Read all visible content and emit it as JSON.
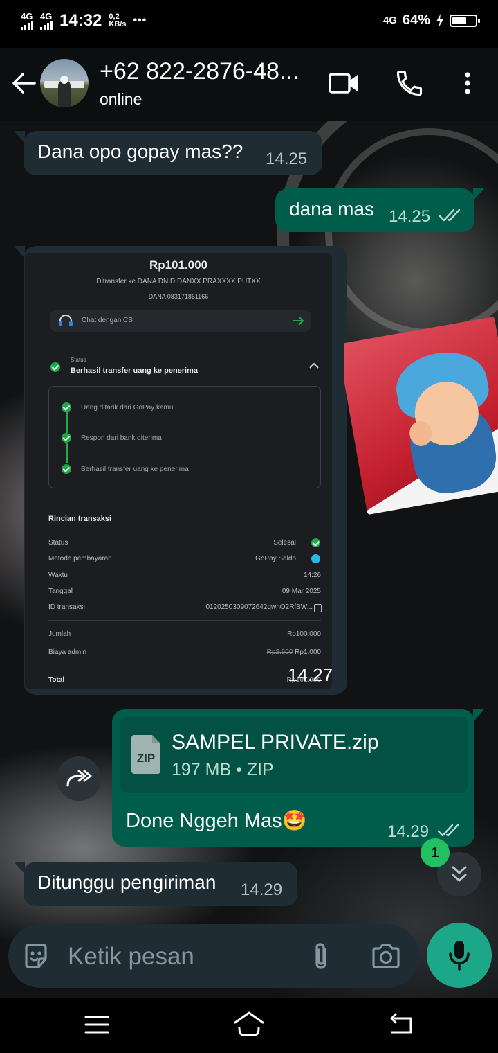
{
  "status_bar": {
    "network_1": "4G",
    "network_2": "4G",
    "time": "14:32",
    "net_speed_value": "0,2",
    "net_speed_unit": "KB/s",
    "more": "•••",
    "network_right": "4G",
    "battery_percent": "64%",
    "battery_level": 0.64
  },
  "header": {
    "contact_name": "+62 822-2876-48...",
    "contact_status": "online"
  },
  "messages": [
    {
      "direction": "in",
      "text": "Dana opo gopay mas??",
      "time": "14.25"
    },
    {
      "direction": "out",
      "text": "dana mas",
      "time": "14.25"
    },
    {
      "direction": "in",
      "type": "image",
      "time": "14.27"
    },
    {
      "direction": "in",
      "type": "sticker"
    },
    {
      "direction": "out",
      "type": "file",
      "file_name": "SAMPEL PRIVATE.zip",
      "file_size": "197 MB",
      "file_type": "ZIP",
      "icon_label": "ZIP",
      "caption": "Done Nggeh Mas🤩",
      "time": "14.29"
    },
    {
      "direction": "in",
      "text": "Ditunggu pengiriman",
      "time": "14.29"
    }
  ],
  "receipt": {
    "amount": "Rp101.000",
    "recipient": "Ditransfer ke DANA DNID DANXX PRAXXXX PUTXX",
    "account": "DANA 083171861166",
    "chat_cs": "Chat dengan CS",
    "status_label": "Status",
    "status_value": "Berhasil transfer uang ke penerima",
    "steps": [
      "Uang ditarik dari GoPay kamu",
      "Respon dari bank diterima",
      "Berhasil transfer uang ke penerima"
    ],
    "details_title": "Rincian transaksi",
    "rows": [
      {
        "label": "Status",
        "value": "Selesai"
      },
      {
        "label": "Metode pembayaran",
        "value": "GoPay Saldo"
      },
      {
        "label": "Waktu",
        "value": "14:26"
      },
      {
        "label": "Tanggal",
        "value": "09 Mar 2025"
      },
      {
        "label": "ID transaksi",
        "value": "0120250309072642qwnO2RfBW..."
      }
    ],
    "jumlah_label": "Jumlah",
    "jumlah_value": "Rp100.000",
    "admin_label": "Biaya admin",
    "admin_old": "Rp2.500",
    "admin_value": "Rp1.000",
    "total_label": "Total",
    "total_value": "Rp101.000"
  },
  "scroll": {
    "unread_count": "1"
  },
  "composer": {
    "placeholder": "Ketik pesan"
  },
  "colors": {
    "incoming": "#1f2c33",
    "outgoing": "#005c4b",
    "accent": "#21c063"
  }
}
